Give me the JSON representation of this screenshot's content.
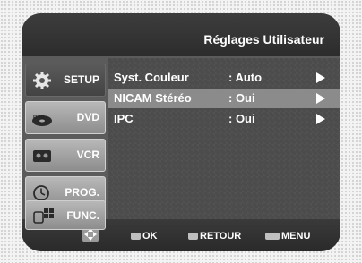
{
  "header": {
    "title": "Réglages Utilisateur"
  },
  "sidebar": {
    "items": [
      {
        "label": "SETUP",
        "icon": "gear-icon",
        "active": true
      },
      {
        "label": "DVD",
        "icon": "dvd-disc-icon",
        "active": false
      },
      {
        "label": "VCR",
        "icon": "vcr-tape-icon",
        "active": false
      },
      {
        "label": "PROG.",
        "icon": "clock-icon",
        "active": false
      },
      {
        "label": "FUNC.",
        "icon": "hand-pointer-icon",
        "active": false
      }
    ]
  },
  "menu": {
    "rows": [
      {
        "label": "Syst. Couleur",
        "value": ": Auto",
        "highlighted": false
      },
      {
        "label": "NICAM Stéréo",
        "value": ": Oui",
        "highlighted": true
      },
      {
        "label": "IPC",
        "value": ": Oui",
        "highlighted": false
      }
    ]
  },
  "footer": {
    "nav_icon": "navigation-pad-icon",
    "ok_label": "OK",
    "back_label": "RETOUR",
    "menu_label": "MENU"
  },
  "colors": {
    "highlight": "#8b8b8b",
    "panel": "#4c4c4c",
    "header": "#2c2c2c"
  }
}
